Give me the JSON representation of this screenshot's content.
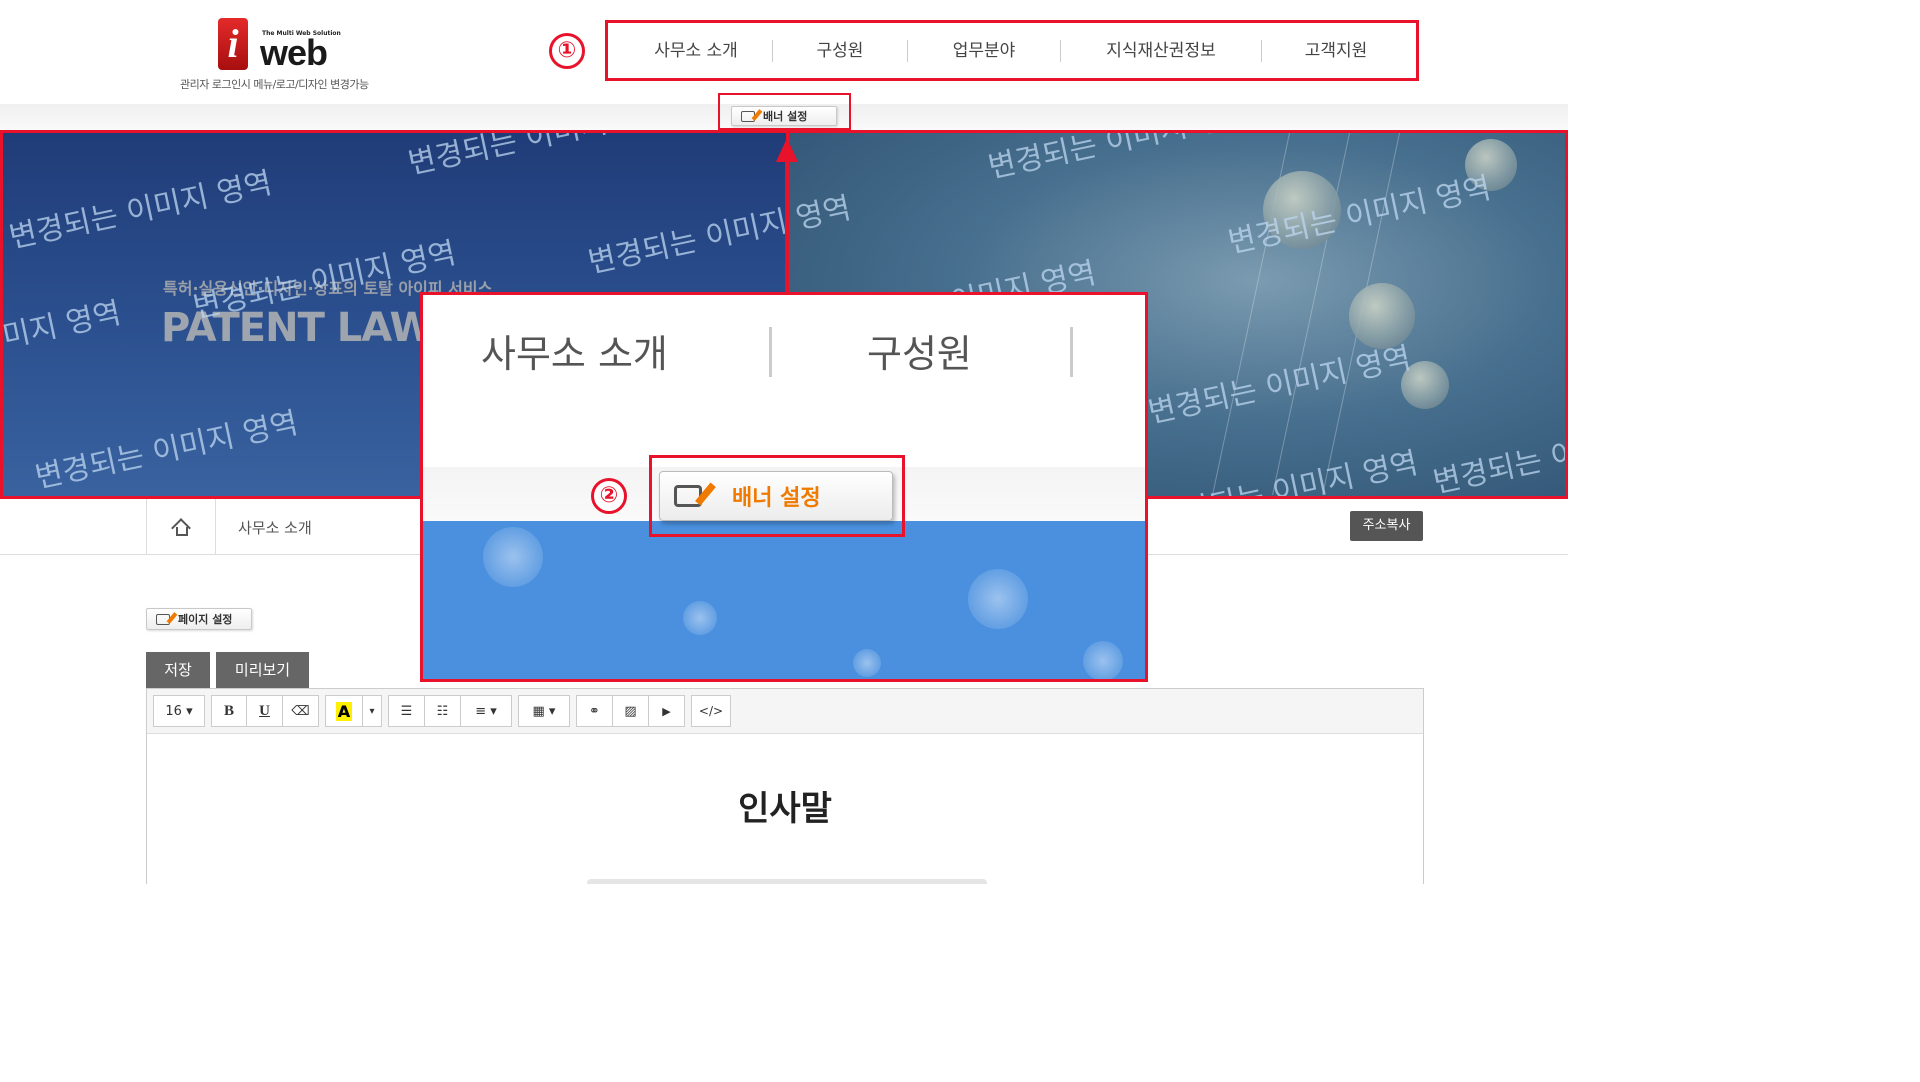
{
  "logo": {
    "mark": "i",
    "tagline": "The Multi Web Solution",
    "wordmark": "web",
    "subtitle": "관리자 로그인시 메뉴/로고/디자인 변경가능"
  },
  "nav": {
    "items": [
      {
        "label": "사무소 소개"
      },
      {
        "label": "구성원"
      },
      {
        "label": "업무분야"
      },
      {
        "label": "지식재산권정보"
      },
      {
        "label": "고객지원"
      }
    ]
  },
  "annotations": {
    "badge_1": "①",
    "badge_2": "②",
    "accent_color": "#e8132b"
  },
  "banner_button": {
    "label": "배너 설정"
  },
  "banner": {
    "subtitle": "특허·실용신안·디자인·상표의 토탈 아이피 서비스",
    "title": "PATENT LAW",
    "watermark": "변경되는 이미지 영역"
  },
  "breadcrumb": {
    "home_icon": "home-icon",
    "current": "사무소 소개",
    "copy_button": "주소복사"
  },
  "page_settings_button": {
    "label": "페이지 설정"
  },
  "editor_tabs": {
    "save": "저장",
    "preview": "미리보기"
  },
  "toolbar": {
    "font_size": "16 ▾",
    "bold": "B",
    "underline": "U",
    "eraser": "⌫",
    "font_color": "A",
    "color_caret": "▾",
    "bullet_list": "☰",
    "ordered_list": "☷",
    "align": "≡ ▾",
    "table": "▦ ▾",
    "link": "⚭",
    "image": "▨",
    "video": "▶",
    "code": "</>"
  },
  "editor": {
    "heading": "인사말"
  },
  "zoom": {
    "nav_items": [
      "사무소 소개",
      "구성원"
    ],
    "button_label": "배너 설정"
  }
}
